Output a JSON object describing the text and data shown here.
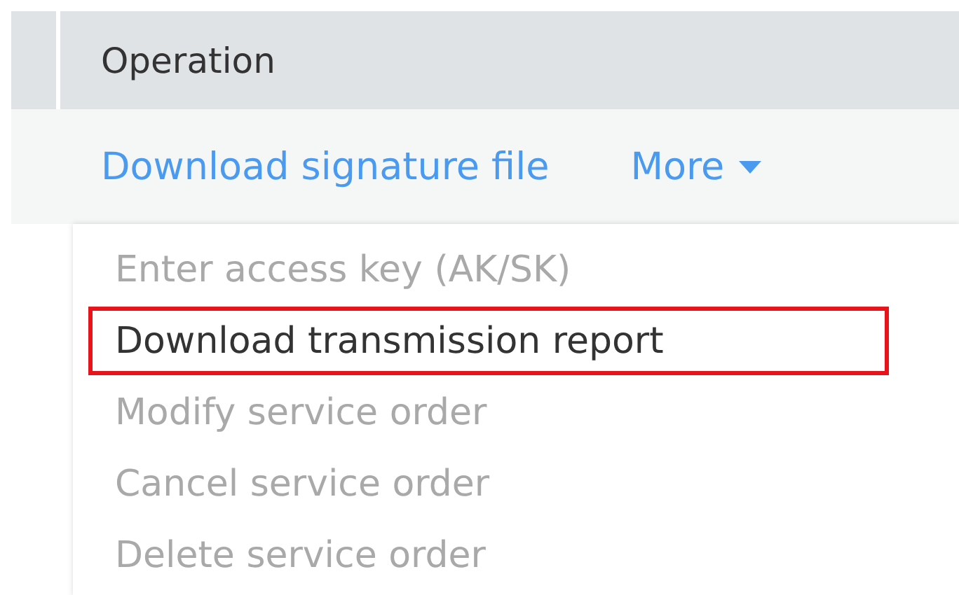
{
  "table": {
    "columns": [
      {
        "label": "Operation"
      }
    ],
    "row": {
      "actions": [
        {
          "label": "Download signature file",
          "kind": "link"
        },
        {
          "label": "More",
          "kind": "dropdown"
        }
      ]
    }
  },
  "menu": {
    "items": [
      {
        "label": "Enter access key (AK/SK)",
        "disabled": true,
        "highlighted": false
      },
      {
        "label": "Download transmission report",
        "disabled": false,
        "highlighted": true
      },
      {
        "label": "Modify service order",
        "disabled": true,
        "highlighted": false
      },
      {
        "label": "Cancel service order",
        "disabled": true,
        "highlighted": false
      },
      {
        "label": "Delete service order",
        "disabled": true,
        "highlighted": false
      }
    ]
  }
}
